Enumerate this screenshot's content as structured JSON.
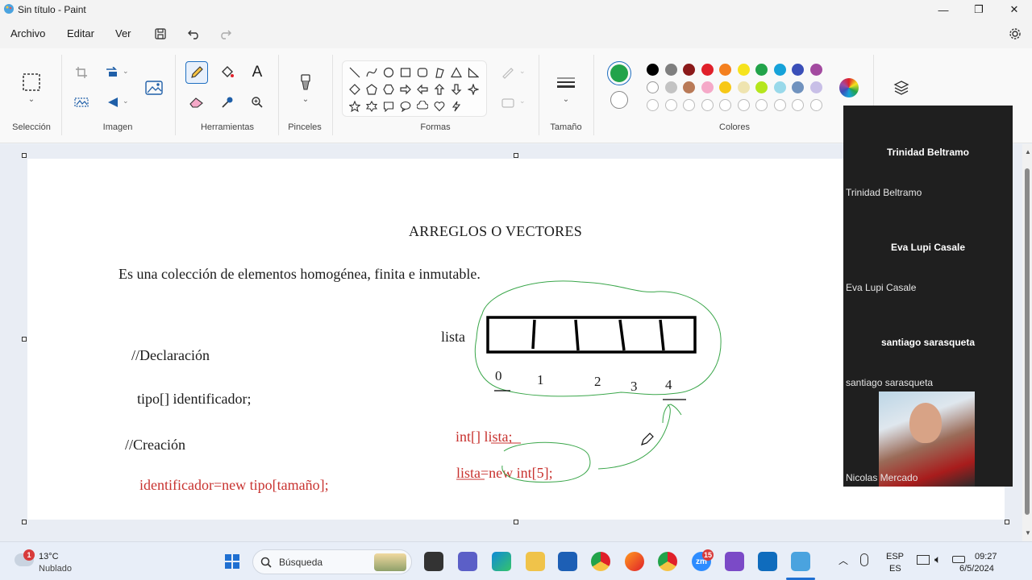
{
  "window": {
    "title": "Sin título - Paint"
  },
  "menu": {
    "items": [
      "Archivo",
      "Editar",
      "Ver"
    ]
  },
  "ribbon": {
    "groups": {
      "seleccion": "Selección",
      "imagen": "Imagen",
      "herramientas": "Herramientas",
      "pinceles": "Pinceles",
      "formas": "Formas",
      "tamano": "Tamaño",
      "colores": "Colores"
    },
    "text_tool": "A",
    "selected_color": "#22a34a",
    "palette_row1": [
      "#000000",
      "#7f7f7f",
      "#8b1a1a",
      "#e0202a",
      "#f4801f",
      "#f6e31d",
      "#22a34a",
      "#16a2d9",
      "#3a4fb8",
      "#a34aa0"
    ],
    "palette_row2": [
      "#ffffff",
      "#c3c3c3",
      "#b97a57",
      "#f5a9c8",
      "#f7c816",
      "#efe4b0",
      "#b5e61d",
      "#99d9ea",
      "#7092be",
      "#c8bfe7"
    ]
  },
  "canvas": {
    "title": "ARREGLOS O VECTORES",
    "definition": "Es una colección de elementos homogénea, finita e inmutable.",
    "declaration_comment": "//Declaración",
    "declaration_code": "tipo[] identificador;",
    "creation_comment": "//Creación",
    "creation_code": "identificador=new tipo[tamaño];",
    "array_label": "lista",
    "indices": [
      "0",
      "1",
      "2",
      "3",
      "4"
    ],
    "example_declaration": "int[] lista;",
    "example_creation": "lista=new int[5];"
  },
  "participants": {
    "p1_name": "Trinidad Beltramo",
    "p1_label": "Trinidad Beltramo",
    "p2_name": "Eva Lupi Casale",
    "p2_label": "Eva Lupi Casale",
    "p3_name": "santiago sarasqueta",
    "p3_label": "santiago sarasqueta",
    "p4_label": "Nicolas Mercado"
  },
  "taskbar": {
    "weather_temp": "13°C",
    "weather_desc": "Nublado",
    "weather_badge": "1",
    "search_placeholder": "Búsqueda",
    "zoom_badge": "15",
    "lang_top": "ESP",
    "lang_bottom": "ES",
    "time": "09:27",
    "date": "6/5/2024"
  }
}
